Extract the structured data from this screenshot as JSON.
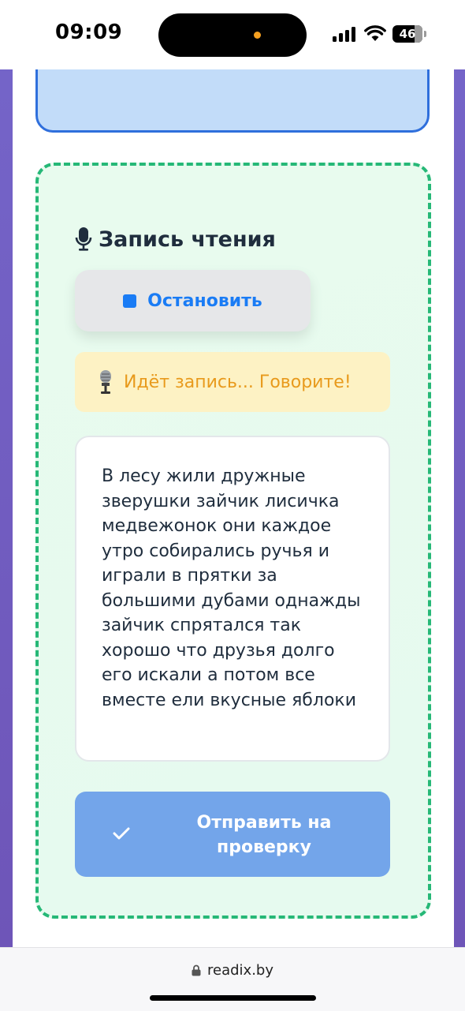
{
  "status_bar": {
    "time": "09:09",
    "battery_level": "46"
  },
  "record_section": {
    "title": "Запись чтения",
    "title_icon": "microphone-icon",
    "stop_button": {
      "label": "Остановить",
      "icon": "stop-square-icon"
    },
    "status": {
      "icon": "studio-microphone-icon",
      "text": "Идёт запись... Говорите!"
    },
    "transcript": "В лесу жили дружные зверушки зайчик лисичка медвежонок они каждое утро собирались ручья и играли в прятки за большими дубами однажды зайчик спрятался так хорошо что друзья долго его искали а потом все вместе ели вкусные яблоки",
    "submit_button": {
      "line1": "Отправить на",
      "line2": "проверку",
      "icon": "check-icon"
    }
  },
  "browser": {
    "url": "readix.by"
  },
  "colors": {
    "primary_blue": "#1a7cf5",
    "dashed_border_green": "#26b877",
    "status_orange": "#e89a1c",
    "submit_bg": "#73a5ea",
    "background_purple": "#7464c8"
  }
}
